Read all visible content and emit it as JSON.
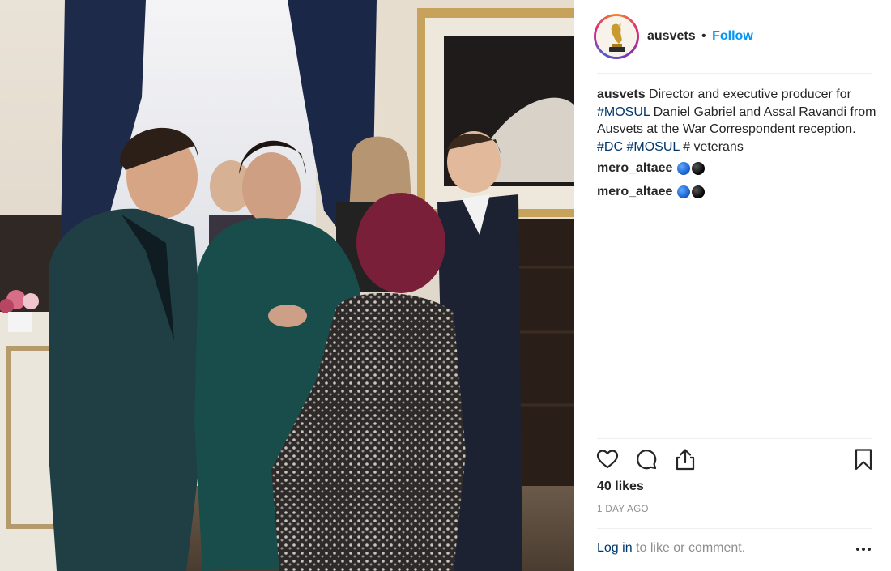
{
  "post": {
    "photo_alt": "",
    "header": {
      "username": "ausvets",
      "separator": "•",
      "follow_label": "Follow"
    },
    "caption": {
      "username": "ausvets",
      "text_1": " Director and executive producer for ",
      "tag_1": "#MOSUL",
      "text_2": " Daniel Gabriel and Assal Ravandi from Ausvets at the War Correspondent reception. ",
      "tag_2": "#DC",
      "text_3": " ",
      "tag_3": "#MOSUL",
      "text_4": " # veterans"
    },
    "comments": [
      {
        "username": "mero_altaee",
        "emoji": [
          "blue-circle-emoji",
          "black-circle-emoji"
        ]
      },
      {
        "username": "mero_altaee",
        "emoji": [
          "blue-circle-emoji",
          "black-circle-emoji"
        ]
      }
    ],
    "actions": {
      "icons": [
        "heart-icon",
        "comment-icon",
        "share-icon",
        "bookmark-icon"
      ]
    },
    "likes": "40 likes",
    "timestamp": "1 DAY AGO",
    "login_prompt": {
      "link": "Log in",
      "text": " to like or comment."
    },
    "colors": {
      "follow": "#0095f6",
      "hashtag": "#00376b",
      "muted": "#8e8e8e",
      "text": "#262626",
      "divider": "#efefef"
    }
  }
}
